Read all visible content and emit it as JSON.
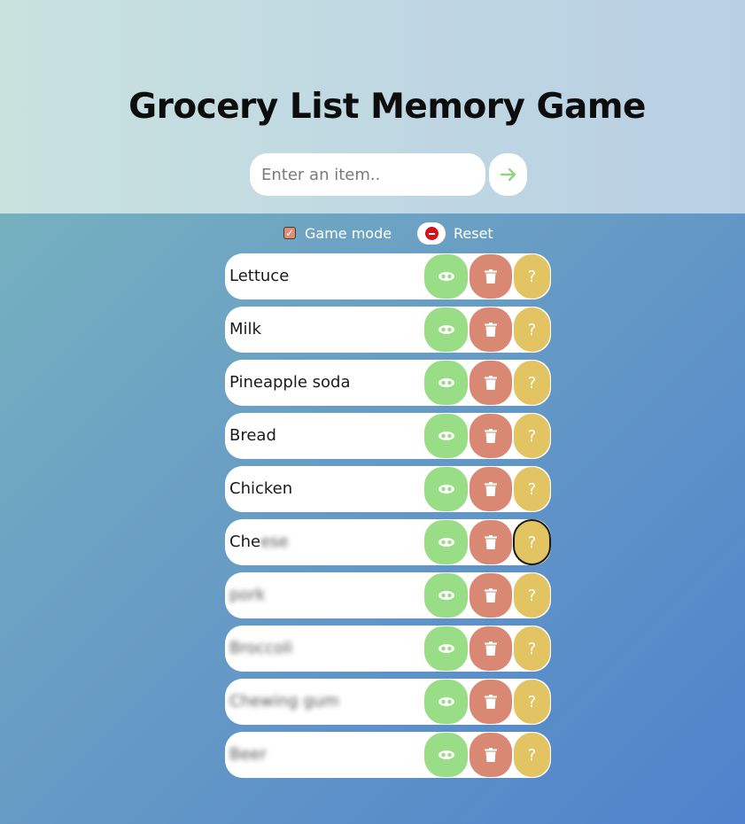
{
  "header": {
    "title": "Grocery List Memory Game",
    "input_placeholder": "Enter an item..",
    "add_icon": "arrow-right-icon"
  },
  "controls": {
    "game_mode_label": "Game mode",
    "game_mode_checked": true,
    "reset_label": "Reset"
  },
  "items": [
    {
      "visible": "Lettuce",
      "hidden": ""
    },
    {
      "visible": "Milk",
      "hidden": ""
    },
    {
      "visible": "Pineapple soda",
      "hidden": ""
    },
    {
      "visible": "Bread",
      "hidden": ""
    },
    {
      "visible": "Chicken",
      "hidden": ""
    },
    {
      "visible": "Che",
      "hidden": "ese"
    },
    {
      "visible": "",
      "hidden": "pork"
    },
    {
      "visible": "",
      "hidden": "Broccoli"
    },
    {
      "visible": "",
      "hidden": "Chewing gum"
    },
    {
      "visible": "",
      "hidden": "Beer"
    }
  ],
  "buttons": {
    "hint_label": "?",
    "eye_icon": "eye-mask-icon",
    "delete_icon": "trash-icon"
  },
  "colors": {
    "eye": "#99dd87",
    "delete": "#d98873",
    "hint": "#e2c462",
    "reset": "#d2121a"
  }
}
